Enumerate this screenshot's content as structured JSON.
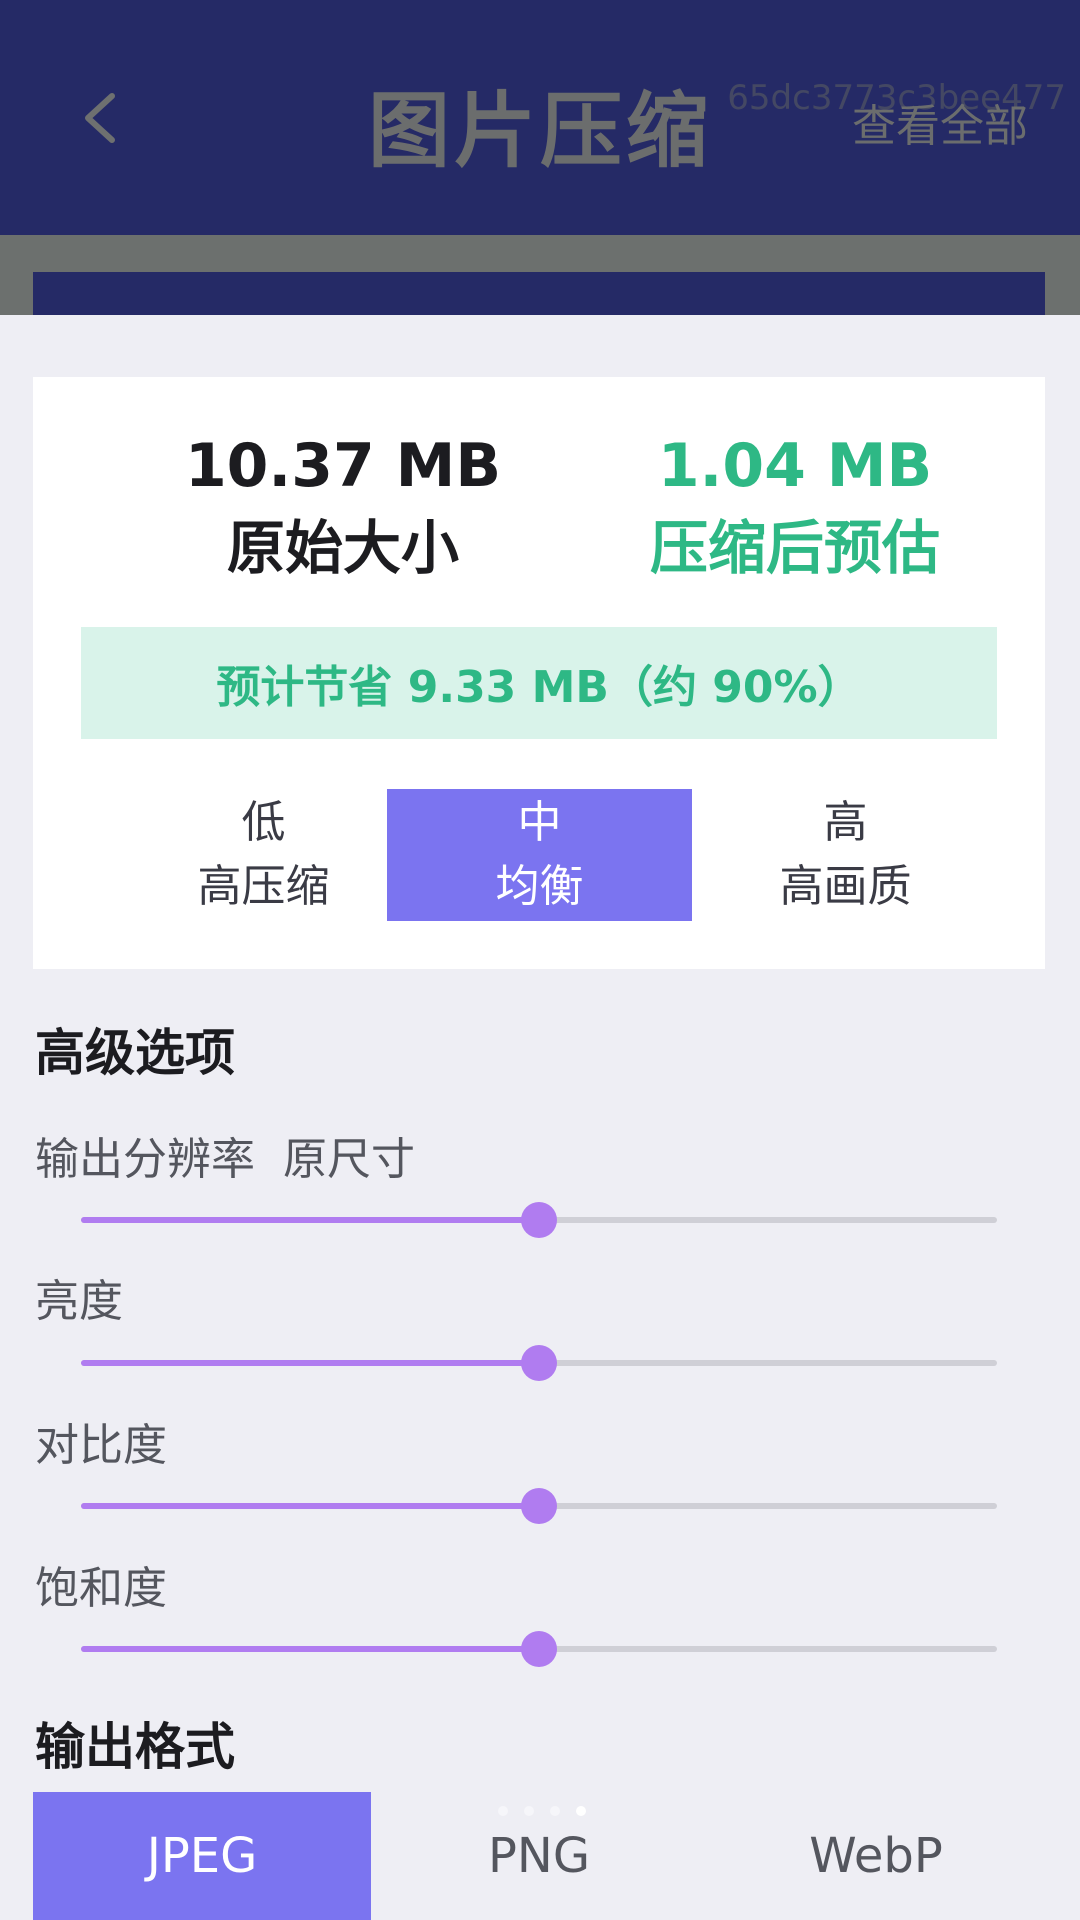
{
  "header": {
    "title": "图片压缩",
    "view_all_label": "查看全部",
    "id_text": "65dc3773c3bee477"
  },
  "summary": {
    "original_size": "10.37 MB",
    "original_label": "原始大小",
    "compressed_size": "1.04 MB",
    "compressed_label": "压缩后预估",
    "savings_text": "预计节省 9.33 MB（约 90%）"
  },
  "quality_options": [
    {
      "level": "低",
      "desc": "高压缩",
      "selected": false
    },
    {
      "level": "中",
      "desc": "均衡",
      "selected": true
    },
    {
      "level": "高",
      "desc": "高画质",
      "selected": false
    }
  ],
  "advanced": {
    "title": "高级选项",
    "sliders": [
      {
        "label": "输出分辨率",
        "value_text": "原尺寸",
        "level": 0.5
      },
      {
        "label": "亮度",
        "value_text": "",
        "level": 0.5
      },
      {
        "label": "对比度",
        "value_text": "",
        "level": 0.5
      },
      {
        "label": "饱和度",
        "value_text": "",
        "level": 0.5
      }
    ]
  },
  "output_format": {
    "title": "输出格式",
    "options": [
      "JPEG",
      "PNG",
      "WebP"
    ],
    "selected": "JPEG"
  },
  "colors": {
    "header_bg": "#252a66",
    "accent": "#7b74f0",
    "slider": "#b07cf0",
    "success": "#2eb885",
    "success_bg": "#d9f3ea"
  }
}
